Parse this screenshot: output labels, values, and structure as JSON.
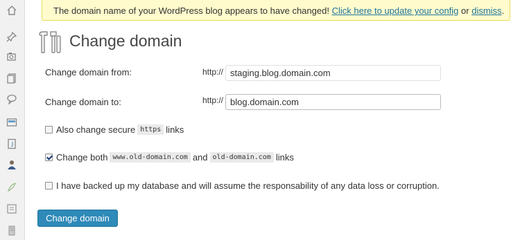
{
  "sidebar": {
    "items": [
      {
        "icon": "dashboard-icon"
      },
      {
        "icon": "posts-pin-icon"
      },
      {
        "icon": "media-icon"
      },
      {
        "icon": "pages-icon"
      },
      {
        "icon": "comments-icon"
      },
      {
        "icon": "appearance-icon"
      },
      {
        "icon": "plugins-icon"
      },
      {
        "icon": "users-icon"
      },
      {
        "icon": "tools-icon"
      },
      {
        "icon": "settings-icon"
      },
      {
        "icon": "building-icon"
      }
    ]
  },
  "notice": {
    "text": "The domain name of your WordPress blog appears to have changed!",
    "update_link": "Click here to update your config",
    "or_text": "or",
    "dismiss_link": "dismiss",
    "period": "."
  },
  "page": {
    "title": "Change domain",
    "title_icon": "tools-icon"
  },
  "form": {
    "from_label": "Change domain from:",
    "from_prefix": "http://",
    "from_value": "staging.blog.domain.com",
    "to_label": "Change domain to:",
    "to_prefix": "http://",
    "to_value": "blog.domain.com",
    "option_https": {
      "checked": false,
      "pre": "Also change secure",
      "code": "https",
      "post": "links"
    },
    "option_www": {
      "checked": true,
      "pre": "Change both",
      "code1": "www.old-domain.com",
      "mid": "and",
      "code2": "old-domain.com",
      "post": "links"
    },
    "option_backup": {
      "checked": false,
      "label": "I have backed up my database and will assume the responsability of any data loss or corruption."
    },
    "submit_label": "Change domain"
  },
  "colors": {
    "notice_bg": "#fffbcc",
    "link": "#21759b",
    "button_bg": "#2e8ab8"
  }
}
